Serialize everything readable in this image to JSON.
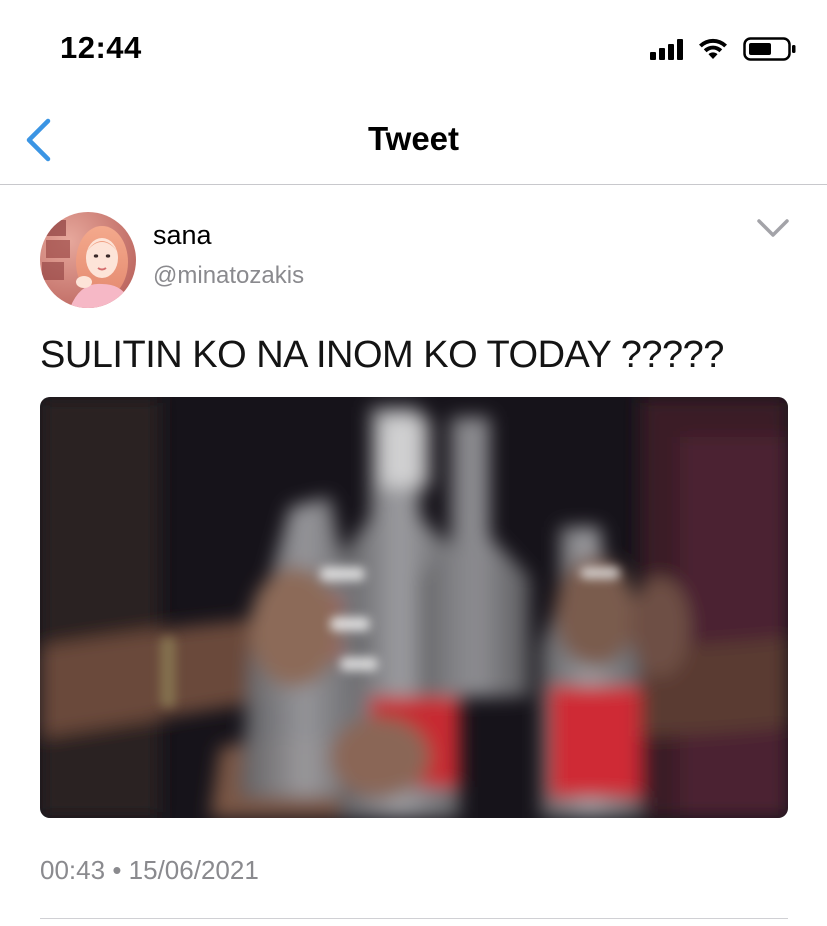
{
  "status_bar": {
    "time": "12:44",
    "icons": [
      "cellular-signal-icon",
      "wifi-icon",
      "battery-icon"
    ]
  },
  "nav": {
    "back_icon": "chevron-left-icon",
    "title": "Tweet",
    "accent_color": "#3b95e4"
  },
  "tweet": {
    "author": {
      "display_name": "sana",
      "handle": "@minatozakis"
    },
    "text": "SULITIN KO NA INOM KO TODAY ?????",
    "media": "photo",
    "time": "00:43",
    "separator": "•",
    "date": "15/06/2021",
    "menu_icon": "chevron-down-icon"
  }
}
